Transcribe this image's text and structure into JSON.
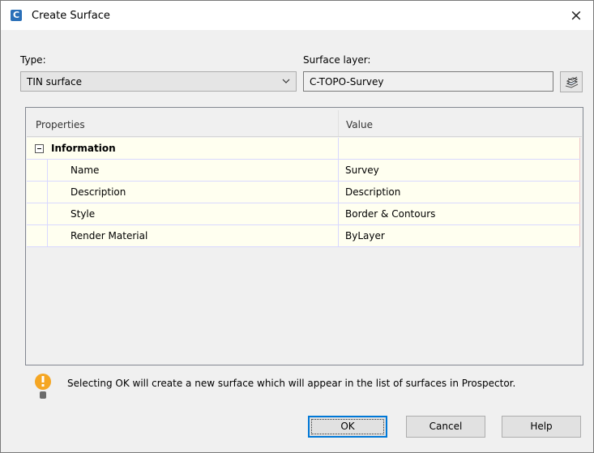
{
  "window": {
    "title": "Create Surface",
    "app_icon_letter": "C",
    "close_glyph": "×"
  },
  "form": {
    "type_label": "Type:",
    "type_value": "TIN surface",
    "surface_layer_label": "Surface layer:",
    "surface_layer_value": "C-TOPO-Survey",
    "layer_button_icon": "layers-icon"
  },
  "grid": {
    "headers": [
      "Properties",
      "Value"
    ],
    "category": {
      "label": "Information",
      "expanded": true,
      "value": ""
    },
    "rows": [
      {
        "name": "Name",
        "value": "Survey"
      },
      {
        "name": "Description",
        "value": "Description"
      },
      {
        "name": "Style",
        "value": "Border & Contours"
      },
      {
        "name": "Render Material",
        "value": "ByLayer"
      }
    ]
  },
  "info": {
    "icon": "info-bulb-icon",
    "message": "Selecting OK will create a new surface which will appear in the list of surfaces in Prospector."
  },
  "buttons": {
    "ok": "OK",
    "cancel": "Cancel",
    "help": "Help"
  },
  "colors": {
    "accent": "#0078d7",
    "app_icon": "#2a6fb8",
    "row_background": "#fffff0",
    "info_icon": "#f5a623"
  }
}
